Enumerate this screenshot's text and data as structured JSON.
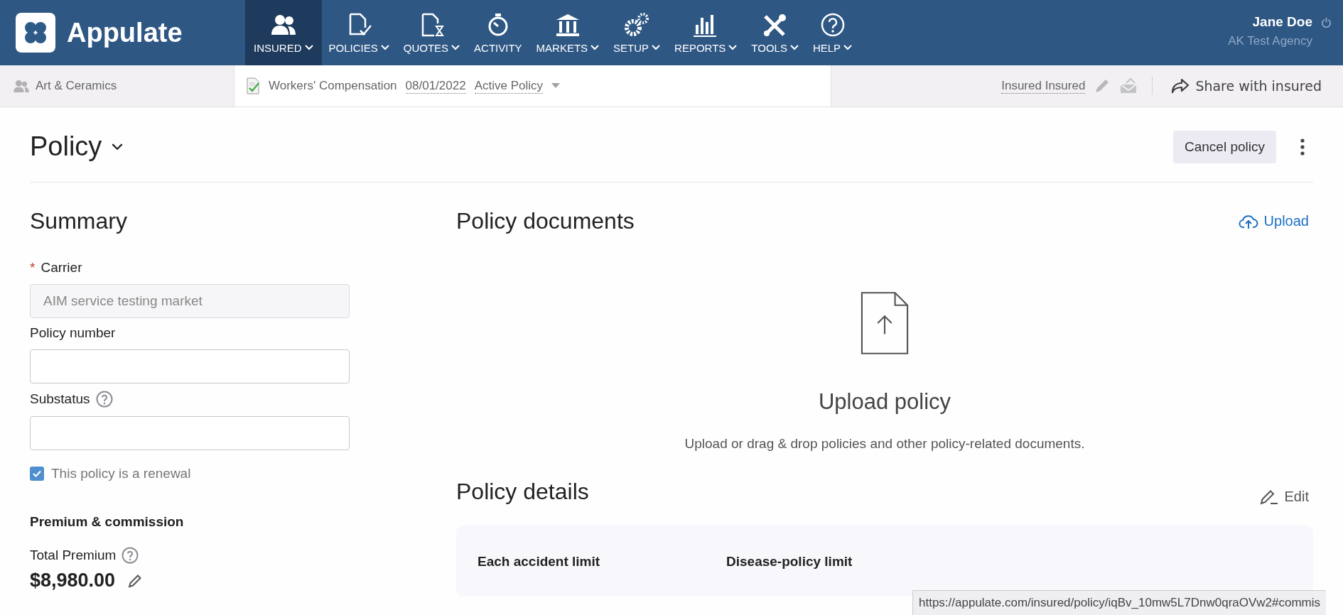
{
  "brand": "Appulate",
  "nav": [
    {
      "label": "INSURED",
      "kind": "people",
      "dropdown": true,
      "selected": true
    },
    {
      "label": "POLICIES",
      "kind": "policy",
      "dropdown": true,
      "selected": false
    },
    {
      "label": "QUOTES",
      "kind": "quote",
      "dropdown": true,
      "selected": false
    },
    {
      "label": "ACTIVITY",
      "kind": "stopwatch",
      "dropdown": false,
      "selected": false
    },
    {
      "label": "MARKETS",
      "kind": "bank",
      "dropdown": true,
      "selected": false
    },
    {
      "label": "SETUP",
      "kind": "gears",
      "dropdown": true,
      "selected": false
    },
    {
      "label": "REPORTS",
      "kind": "chart",
      "dropdown": true,
      "selected": false
    },
    {
      "label": "TOOLS",
      "kind": "tools",
      "dropdown": true,
      "selected": false
    },
    {
      "label": "HELP",
      "kind": "help",
      "dropdown": true,
      "selected": false
    }
  ],
  "user": {
    "name": "Jane Doe",
    "agency": "AK Test Agency"
  },
  "context_bar": {
    "insured": "Art & Ceramics",
    "line": "Workers' Compensation",
    "date": "08/01/2022",
    "status": "Active Policy",
    "contact": "Insured Insured",
    "share": "Share with insured"
  },
  "page": {
    "title": "Policy",
    "cancel_button": "Cancel policy"
  },
  "summary": {
    "title": "Summary",
    "fields": [
      {
        "required_mark": "*",
        "label": "Carrier",
        "help": false,
        "value": "AIM service testing market",
        "disabled": true
      },
      {
        "label": "Policy number",
        "help": false,
        "disabled": false
      },
      {
        "label": "Substatus",
        "help": true,
        "disabled": false
      }
    ],
    "renewal": {
      "label": "This policy is a renewal",
      "checked": true
    },
    "premium_title": "Premium & commission",
    "total_premium_label": "Total Premium",
    "total_premium": "$8,980.00"
  },
  "documents": {
    "title": "Policy documents",
    "upload": "Upload",
    "empty_title": "Upload policy",
    "empty_text": "Upload or drag & drop policies and other policy-related documents."
  },
  "details": {
    "title": "Policy details",
    "edit": "Edit",
    "limits": [
      "Each accident limit",
      "Disease-policy limit"
    ]
  },
  "status_url": "https://appulate.com/insured/policy/iqBv_10mw5L7Dnw0qraOVw2#commis"
}
